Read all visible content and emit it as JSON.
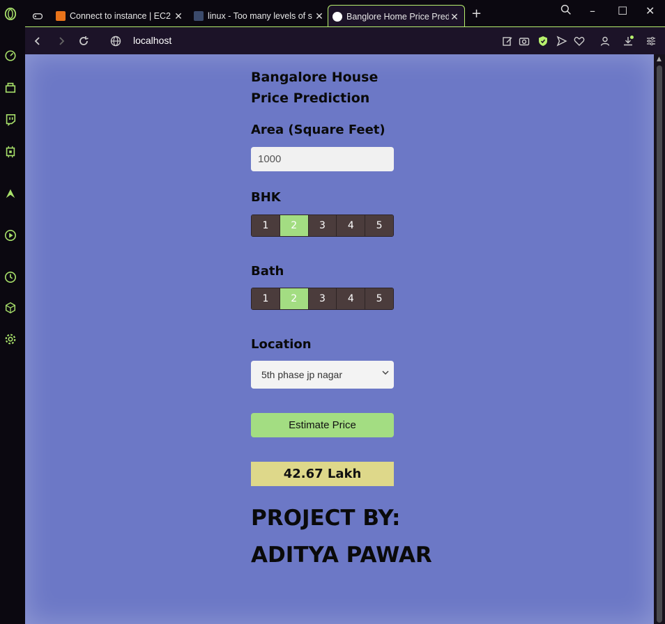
{
  "browser": {
    "tabs": [
      {
        "title": "Connect to instance | EC2 |",
        "favicon_color": "#e8731a"
      },
      {
        "title": "linux - Too many levels of s",
        "favicon_color": "#3b4a6b"
      },
      {
        "title": "Banglore Home Price Predic",
        "favicon_color": "#ffffff",
        "active": true
      }
    ],
    "new_tab_label": "+",
    "url": "localhost",
    "accent_color": "#b7f06d"
  },
  "page": {
    "title": "Bangalore House Price Prediction",
    "area_label": "Area (Square Feet)",
    "area_value": "1000",
    "bhk_label": "BHK",
    "bhk_options": [
      "1",
      "2",
      "3",
      "4",
      "5"
    ],
    "bhk_selected": "2",
    "bath_label": "Bath",
    "bath_options": [
      "1",
      "2",
      "3",
      "4",
      "5"
    ],
    "bath_selected": "2",
    "location_label": "Location",
    "location_value": "5th phase jp nagar",
    "estimate_button": "Estimate Price",
    "result": "42.67 Lakh",
    "credit_line1": "PROJECT BY:",
    "credit_line2": "ADITYA PAWAR",
    "background_color": "#6c78c6",
    "selected_color": "#a3dd82",
    "result_color": "#ded88a"
  }
}
